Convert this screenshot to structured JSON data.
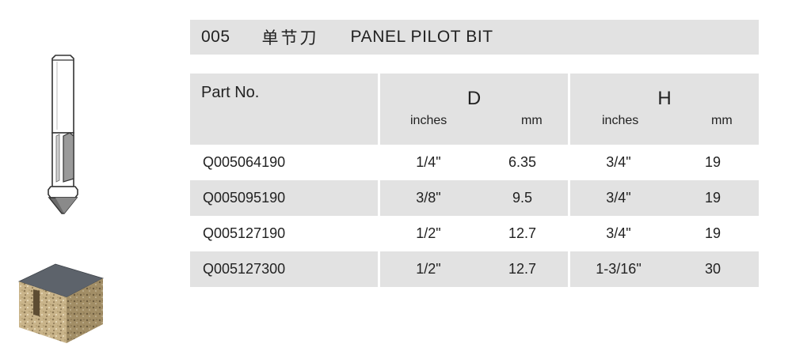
{
  "product": {
    "code": "005",
    "name_cn": "单节刀",
    "name_en": "PANEL PILOT BIT"
  },
  "table": {
    "part_no_label": "Part No.",
    "d_label": "D",
    "h_label": "H",
    "inches_label": "inches",
    "mm_label": "mm",
    "rows": [
      {
        "part": "Q005064190",
        "d_in": "1/4\"",
        "d_mm": "6.35",
        "h_in": "3/4\"",
        "h_mm": "19"
      },
      {
        "part": "Q005095190",
        "d_in": "3/8\"",
        "d_mm": "9.5",
        "h_in": "3/4\"",
        "h_mm": "19"
      },
      {
        "part": "Q005127190",
        "d_in": "1/2\"",
        "d_mm": "12.7",
        "h_in": "3/4\"",
        "h_mm": "19"
      },
      {
        "part": "Q005127300",
        "d_in": "1/2\"",
        "d_mm": "12.7",
        "h_in": "1-3/16\"",
        "h_mm": "30"
      }
    ]
  }
}
